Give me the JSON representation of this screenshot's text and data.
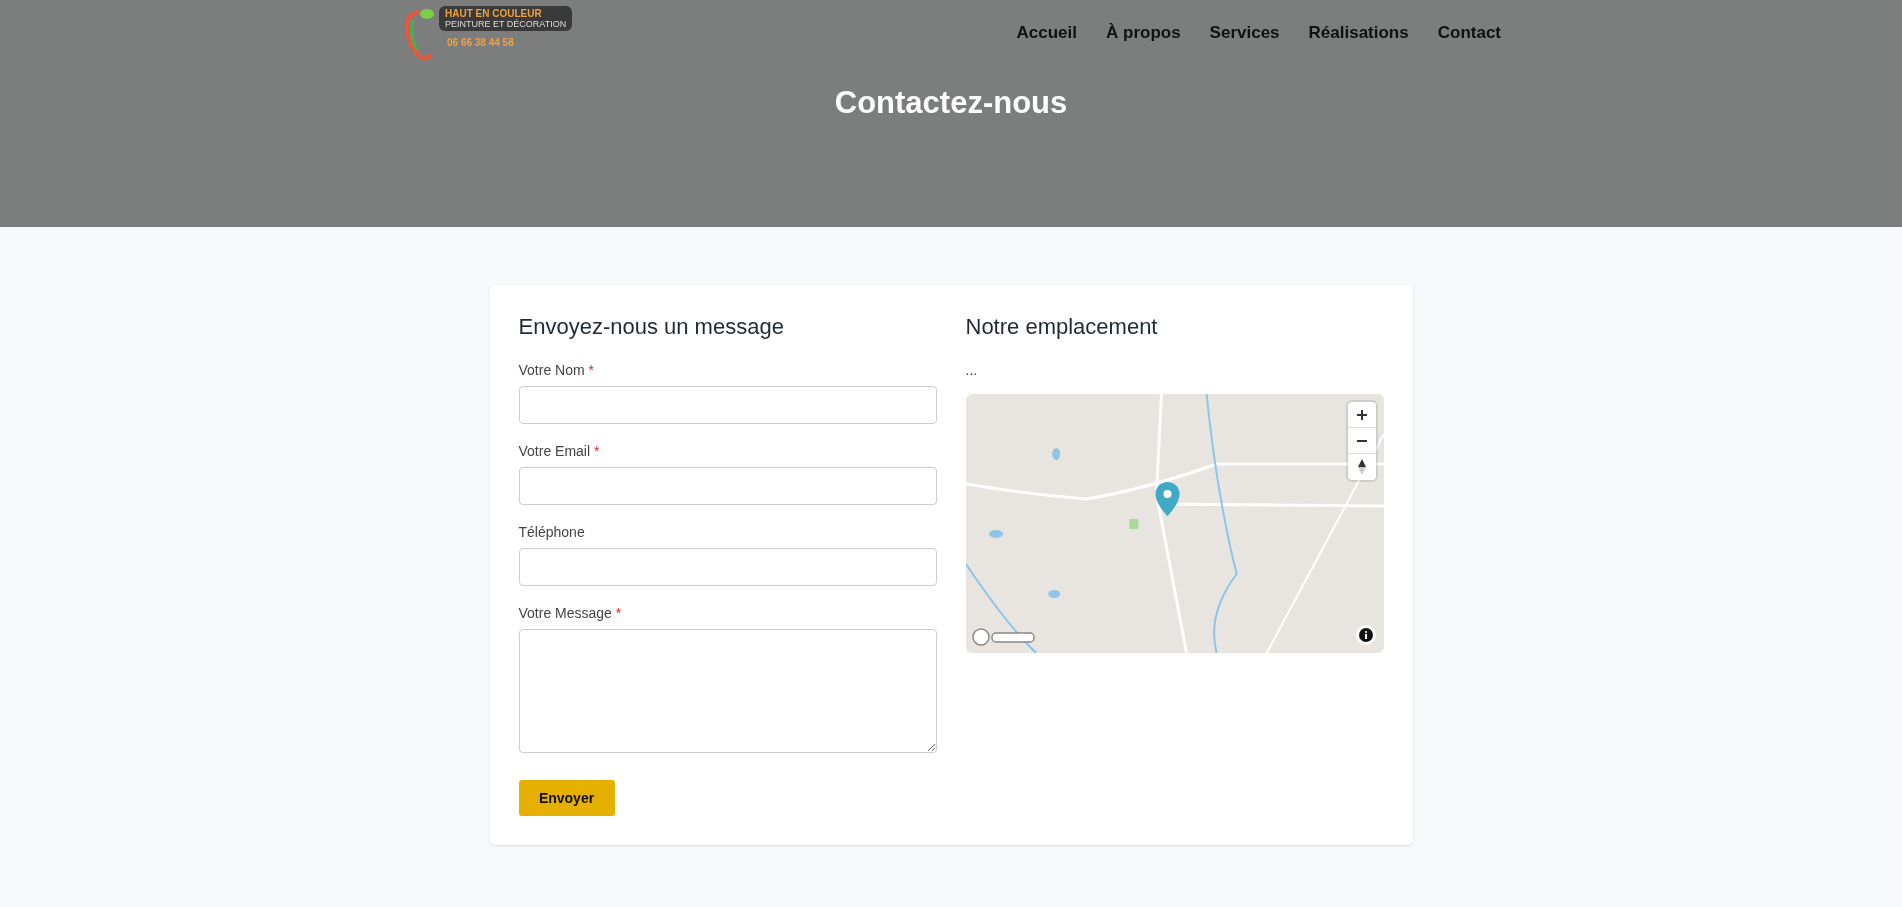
{
  "logo": {
    "brand": "HAUT EN COULEUR",
    "tagline": "PEINTURE ET DÉCORATION",
    "phone": "06 66 38 44 58"
  },
  "nav": [
    {
      "label": "Accueil",
      "selected": false
    },
    {
      "label": "À propos",
      "selected": false
    },
    {
      "label": "Services",
      "selected": false
    },
    {
      "label": "Réalisations",
      "selected": false
    },
    {
      "label": "Contact",
      "selected": false
    }
  ],
  "hero": {
    "title": "Contactez-nous"
  },
  "form": {
    "title": "Envoyez-nous un message",
    "required_marker": "*",
    "fields": [
      {
        "label": "Votre Nom",
        "required": true,
        "kind": "input"
      },
      {
        "label": "Votre Email",
        "required": true,
        "kind": "input"
      },
      {
        "label": "Téléphone",
        "required": false,
        "kind": "input"
      },
      {
        "label": "Votre Message",
        "required": true,
        "kind": "textarea"
      }
    ],
    "submit": "Envoyer"
  },
  "location": {
    "title": "Notre emplacement",
    "address": "..."
  }
}
